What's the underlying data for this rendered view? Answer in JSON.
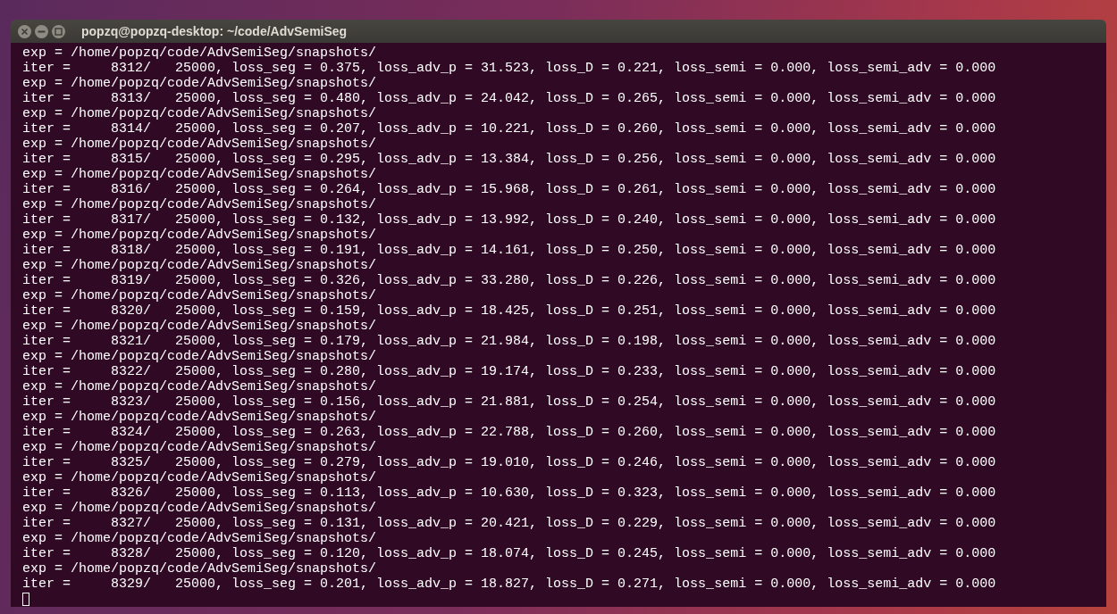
{
  "window": {
    "title": "popzq@popzq-desktop: ~/code/AdvSemiSeg"
  },
  "terminal": {
    "lines": [
      "exp = /home/popzq/code/AdvSemiSeg/snapshots/",
      "iter =     8312/   25000, loss_seg = 0.375, loss_adv_p = 31.523, loss_D = 0.221, loss_semi = 0.000, loss_semi_adv = 0.000",
      "exp = /home/popzq/code/AdvSemiSeg/snapshots/",
      "iter =     8313/   25000, loss_seg = 0.480, loss_adv_p = 24.042, loss_D = 0.265, loss_semi = 0.000, loss_semi_adv = 0.000",
      "exp = /home/popzq/code/AdvSemiSeg/snapshots/",
      "iter =     8314/   25000, loss_seg = 0.207, loss_adv_p = 10.221, loss_D = 0.260, loss_semi = 0.000, loss_semi_adv = 0.000",
      "exp = /home/popzq/code/AdvSemiSeg/snapshots/",
      "iter =     8315/   25000, loss_seg = 0.295, loss_adv_p = 13.384, loss_D = 0.256, loss_semi = 0.000, loss_semi_adv = 0.000",
      "exp = /home/popzq/code/AdvSemiSeg/snapshots/",
      "iter =     8316/   25000, loss_seg = 0.264, loss_adv_p = 15.968, loss_D = 0.261, loss_semi = 0.000, loss_semi_adv = 0.000",
      "exp = /home/popzq/code/AdvSemiSeg/snapshots/",
      "iter =     8317/   25000, loss_seg = 0.132, loss_adv_p = 13.992, loss_D = 0.240, loss_semi = 0.000, loss_semi_adv = 0.000",
      "exp = /home/popzq/code/AdvSemiSeg/snapshots/",
      "iter =     8318/   25000, loss_seg = 0.191, loss_adv_p = 14.161, loss_D = 0.250, loss_semi = 0.000, loss_semi_adv = 0.000",
      "exp = /home/popzq/code/AdvSemiSeg/snapshots/",
      "iter =     8319/   25000, loss_seg = 0.326, loss_adv_p = 33.280, loss_D = 0.226, loss_semi = 0.000, loss_semi_adv = 0.000",
      "exp = /home/popzq/code/AdvSemiSeg/snapshots/",
      "iter =     8320/   25000, loss_seg = 0.159, loss_adv_p = 18.425, loss_D = 0.251, loss_semi = 0.000, loss_semi_adv = 0.000",
      "exp = /home/popzq/code/AdvSemiSeg/snapshots/",
      "iter =     8321/   25000, loss_seg = 0.179, loss_adv_p = 21.984, loss_D = 0.198, loss_semi = 0.000, loss_semi_adv = 0.000",
      "exp = /home/popzq/code/AdvSemiSeg/snapshots/",
      "iter =     8322/   25000, loss_seg = 0.280, loss_adv_p = 19.174, loss_D = 0.233, loss_semi = 0.000, loss_semi_adv = 0.000",
      "exp = /home/popzq/code/AdvSemiSeg/snapshots/",
      "iter =     8323/   25000, loss_seg = 0.156, loss_adv_p = 21.881, loss_D = 0.254, loss_semi = 0.000, loss_semi_adv = 0.000",
      "exp = /home/popzq/code/AdvSemiSeg/snapshots/",
      "iter =     8324/   25000, loss_seg = 0.263, loss_adv_p = 22.788, loss_D = 0.260, loss_semi = 0.000, loss_semi_adv = 0.000",
      "exp = /home/popzq/code/AdvSemiSeg/snapshots/",
      "iter =     8325/   25000, loss_seg = 0.279, loss_adv_p = 19.010, loss_D = 0.246, loss_semi = 0.000, loss_semi_adv = 0.000",
      "exp = /home/popzq/code/AdvSemiSeg/snapshots/",
      "iter =     8326/   25000, loss_seg = 0.113, loss_adv_p = 10.630, loss_D = 0.323, loss_semi = 0.000, loss_semi_adv = 0.000",
      "exp = /home/popzq/code/AdvSemiSeg/snapshots/",
      "iter =     8327/   25000, loss_seg = 0.131, loss_adv_p = 20.421, loss_D = 0.229, loss_semi = 0.000, loss_semi_adv = 0.000",
      "exp = /home/popzq/code/AdvSemiSeg/snapshots/",
      "iter =     8328/   25000, loss_seg = 0.120, loss_adv_p = 18.074, loss_D = 0.245, loss_semi = 0.000, loss_semi_adv = 0.000",
      "exp = /home/popzq/code/AdvSemiSeg/snapshots/",
      "iter =     8329/   25000, loss_seg = 0.201, loss_adv_p = 18.827, loss_D = 0.271, loss_semi = 0.000, loss_semi_adv = 0.000"
    ]
  }
}
